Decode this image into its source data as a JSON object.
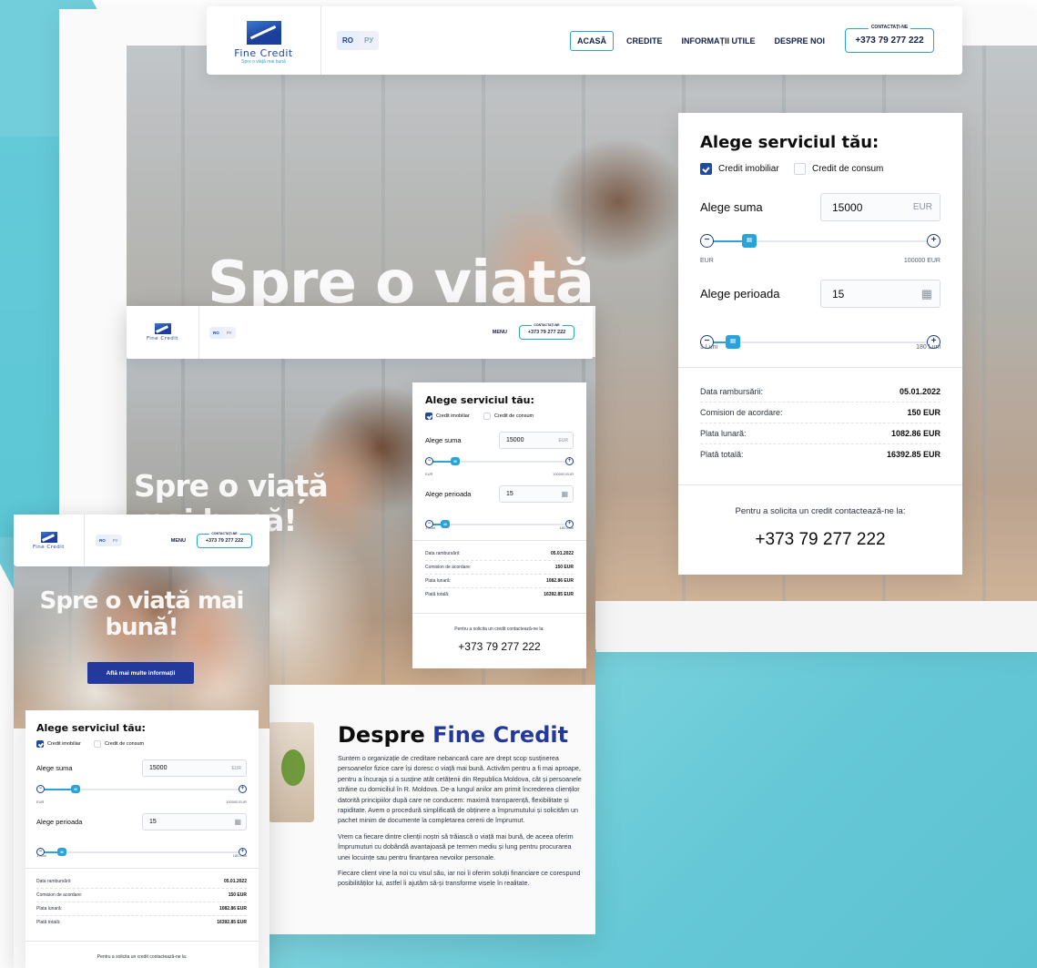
{
  "brand": {
    "name": "Fine Credit",
    "tagline": "Spre o viață mai bună"
  },
  "languages": [
    "RO",
    "РУ"
  ],
  "nav": {
    "items": [
      "ACASĂ",
      "CREDITE",
      "INFORMAȚII UTILE",
      "DESPRE NOI"
    ],
    "menu_label": "MENU"
  },
  "contact": {
    "label": "CONTACTAȚI-NE",
    "phone": "+373 79 277 222"
  },
  "hero": {
    "title": "Spre o viață",
    "title_mobile": "Spre o viață mai bună!",
    "cta": "Află mai multe informații"
  },
  "calculator": {
    "title": "Alege serviciul tău:",
    "options": [
      {
        "label": "Credit imobiliar",
        "checked": true
      },
      {
        "label": "Credit de consum",
        "checked": false
      }
    ],
    "amount": {
      "label": "Alege suma",
      "value": "15000",
      "unit": "EUR",
      "min": "EUR",
      "max": "100000 EUR"
    },
    "period": {
      "label": "Alege perioada",
      "value": "15",
      "min": "1 Luni",
      "max": "180 Luni"
    },
    "summary": [
      {
        "key": "Data rambursării:",
        "value": "05.01.2022"
      },
      {
        "key": "Comision de acordare:",
        "value": "150 EUR"
      },
      {
        "key": "Plata lunară:",
        "value": "1082.86 EUR"
      },
      {
        "key": "Plată totală:",
        "value": "16392.85 EUR"
      }
    ],
    "contact_text": "Pentru a solicita un credit contactează-ne la:",
    "contact_phone": "+373 79 277 222"
  },
  "about": {
    "title_prefix": "Despre",
    "title_accent": "Fine Credit",
    "paragraphs": [
      "Suntem o organizație de creditare nebancară care are drept scop susținerea persoanelor fizice care își doresc o viață mai bună. Activăm pentru a fi mai aproape, pentru a încuraja și a susține atât cetățenii din Republica Moldova, cât și persoanele străine cu domiciliul în R. Moldova. De-a lungul anilor am primit încrederea clienților datorită principiilor după care ne conducem: maximă transparență, flexibilitate și rapiditate. Avem o procedură simplificată de obținere a împrumutului și solicităm un pachet minim de documente la completarea cererii de împrumut.",
      "Vrem ca fiecare dintre clienții noștri să trăiască o viață mai bună, de aceea oferim împrumuturi cu dobândă avantajoasă pe termen mediu și lung pentru procurarea unei locuințe sau pentru finanțarea nevoilor personale.",
      "Fiecare client vine la noi cu visul său, iar noi îi oferim soluții financiare ce corespund posibilităților lui, astfel îi ajutăm să-și transforme visele în realitate."
    ]
  },
  "colors": {
    "accent": "#2aa4d8",
    "brand": "#1f49a3",
    "dark_blue": "#23399b",
    "teal_bg": "#66c8d6"
  }
}
